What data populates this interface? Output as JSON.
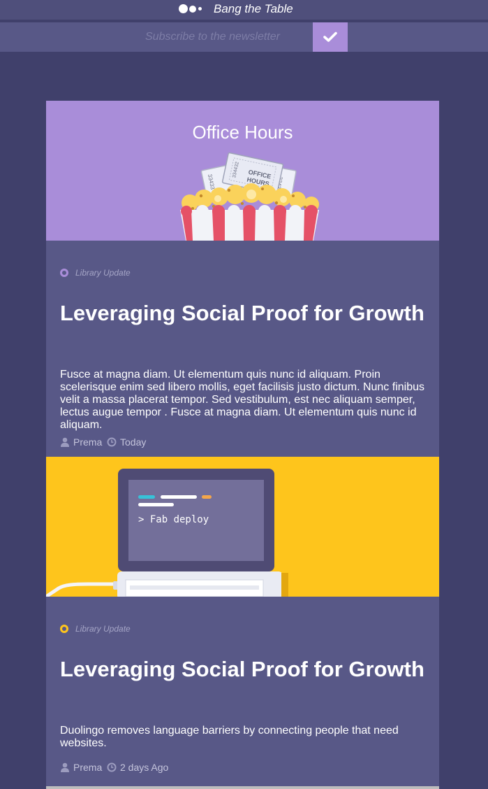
{
  "header": {
    "brand_name": "Bang the Table",
    "logo_icon": "three-dots-logo-icon"
  },
  "newsletter": {
    "placeholder": "Subscribe to the newsletter",
    "submit_icon": "checkmark-icon",
    "accent_color": "#a98dd9"
  },
  "posts": [
    {
      "image": {
        "heading": "Office Hours",
        "illustration": "popcorn-with-tickets",
        "ticket_text": "OFFICE HOURS",
        "ticket_numbers": [
          "33433",
          "334432",
          "33433"
        ],
        "background": "#a98dd9"
      },
      "tag": "Library Update",
      "tag_color": "#a98dd9",
      "title": "Leveraging Social Proof for Growth",
      "excerpt": "Fusce at magna diam. Ut elementum quis nunc id aliquam. Proin scelerisque enim sed libero mollis, eget facilisis justo dictum. Nunc finibus velit a massa placerat tempor. Sed vestibulum, est nec aliquam semper, lectus augue tempor . Fusce at magna diam. Ut elementum quis nunc id aliquam.",
      "author": "Prema",
      "date": "Today",
      "author_icon": "user-icon",
      "date_icon": "clock-icon"
    },
    {
      "image": {
        "terminal_text": "> Fab deploy",
        "illustration": "laptop-terminal",
        "background": "#fec51c"
      },
      "tag": "Library Update",
      "tag_color": "#fec51c",
      "title": "Leveraging Social Proof for Growth",
      "excerpt": "Duolingo removes language barriers by connecting people that need websites.",
      "author": "Prema",
      "date": "2 days Ago",
      "author_icon": "user-icon",
      "date_icon": "clock-icon"
    }
  ],
  "theme": {
    "page_background": "#40406b",
    "card_background": "#585887"
  }
}
